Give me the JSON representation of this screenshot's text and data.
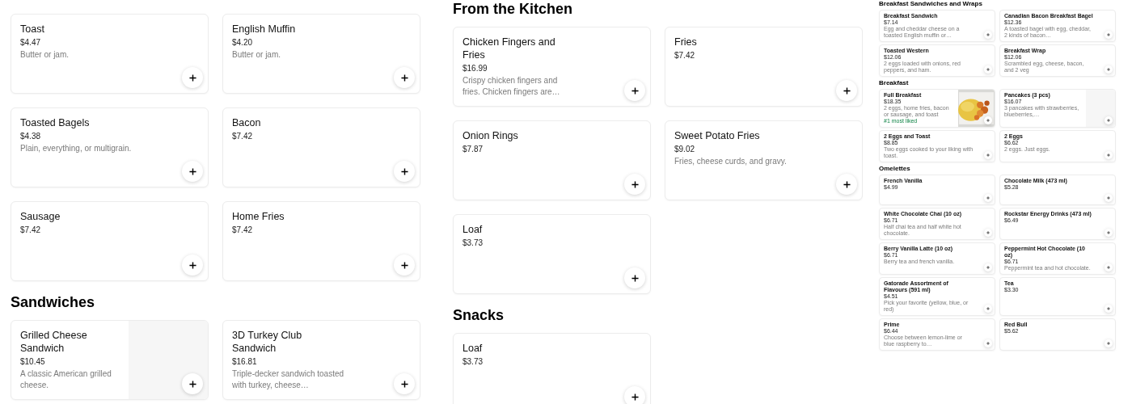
{
  "columns": [
    {
      "kind": "main",
      "sections": [
        {
          "items": [
            {
              "name": "Toast",
              "price": "$4.47",
              "description": "Butter or jam."
            },
            {
              "name": "English Muffin",
              "price": "$4.20",
              "description": "Butter or jam."
            },
            {
              "name": "Toasted Bagels",
              "price": "$4.38",
              "description": "Plain, everything, or multigrain."
            },
            {
              "name": "Bacon",
              "price": "$7.42"
            },
            {
              "name": "Sausage",
              "price": "$7.42"
            },
            {
              "name": "Home Fries",
              "price": "$7.42"
            }
          ]
        },
        {
          "title": "Sandwiches",
          "items": [
            {
              "name": "Grilled Cheese Sandwich",
              "price": "$10.45",
              "description": "A classic American grilled cheese.",
              "kind": "placeholder"
            },
            {
              "name": "3D Turkey Club Sandwich",
              "price": "$16.81",
              "description": "Triple-decker sandwich toasted with turkey, cheese…"
            }
          ]
        }
      ]
    },
    {
      "kind": "main",
      "sections": [
        {
          "title": "From the Kitchen",
          "items": [
            {
              "name": "Chicken Fingers and Fries",
              "price": "$16.99",
              "description": "Crispy chicken fingers and fries. Chicken fingers are…"
            },
            {
              "name": "Fries",
              "price": "$7.42"
            },
            {
              "name": "Onion Rings",
              "price": "$7.87"
            },
            {
              "name": "Sweet Potato Fries",
              "price": "$9.02",
              "description": "Fries, cheese curds, and gravy."
            },
            {
              "name": "Loaf",
              "price": "$3.73"
            }
          ]
        },
        {
          "title": "Snacks",
          "items": [
            {
              "name": "Loaf",
              "price": "$3.73"
            }
          ]
        }
      ]
    },
    {
      "kind": "mini",
      "sections": [
        {
          "title": "Breakfast Sandwiches and Wraps",
          "items": [
            {
              "name": "Breakfast Sandwich",
              "price": "$7.14",
              "description": "Egg and cheddar cheese on a toasted English muffin or…"
            },
            {
              "name": "Canadian Bacon Breakfast Bagel",
              "price": "$12.36",
              "description": "A toasted bagel with egg, cheddar, 2 kinds of bacon…"
            },
            {
              "name": "Toasted Western",
              "price": "$12.06",
              "description": "2 eggs loaded with onions, red peppers, and ham."
            },
            {
              "name": "Breakfast Wrap",
              "price": "$12.06",
              "description": "Scrambled egg, cheese, bacon, and 2 veg"
            }
          ]
        },
        {
          "title": "Breakfast",
          "items": [
            {
              "name": "Full Breakfast",
              "price": "$18.35",
              "description": "2 eggs, home fries, bacon or sausage, and toast",
              "badge": "#1 most liked"
            },
            {
              "name": "Pancakes (3 pcs)",
              "price": "$16.07",
              "description": "3 pancakes with strawberries, blueberries,…",
              "kind": "placeholder"
            },
            {
              "name": "2 Eggs and Toast",
              "price": "$8.85",
              "description": "Two eggs cooked to your liking with toast."
            },
            {
              "name": "2 Eggs",
              "price": "$6.62",
              "description": "2 eggs. Just eggs."
            }
          ]
        },
        {
          "title": "Omelettes",
          "items": [
            {
              "name": "French Vanilla",
              "price": "$4.99"
            },
            {
              "name": "Chocolate Milk (473 ml)",
              "price": "$5.28"
            },
            {
              "name": "White Chocolate Chai (10 oz)",
              "price": "$6.71",
              "description": "Half chai tea and half white hot chocolate."
            },
            {
              "name": "Rockstar Energy Drinks (473 ml)",
              "price": "$6.49"
            },
            {
              "name": "Berry Vanilla Latte (10 oz)",
              "price": "$6.71",
              "description": "Berry tea and french vanilla."
            },
            {
              "name": "Peppermint Hot Chocolate (10 oz)",
              "price": "$6.71",
              "description": "Peppermint tea and hot chocolate."
            },
            {
              "name": "Gatorade Assortment of Flavours (591 ml)",
              "price": "$4.51",
              "description": "Pick your favorite (yellow, blue, or red)"
            },
            {
              "name": "Tea",
              "price": "$3.30"
            },
            {
              "name": "Prime",
              "price": "$6.44",
              "description": "Choose between lemon-lime or blue raspberry to…"
            },
            {
              "name": "Red Bull",
              "price": "$5.62"
            }
          ]
        }
      ]
    }
  ]
}
